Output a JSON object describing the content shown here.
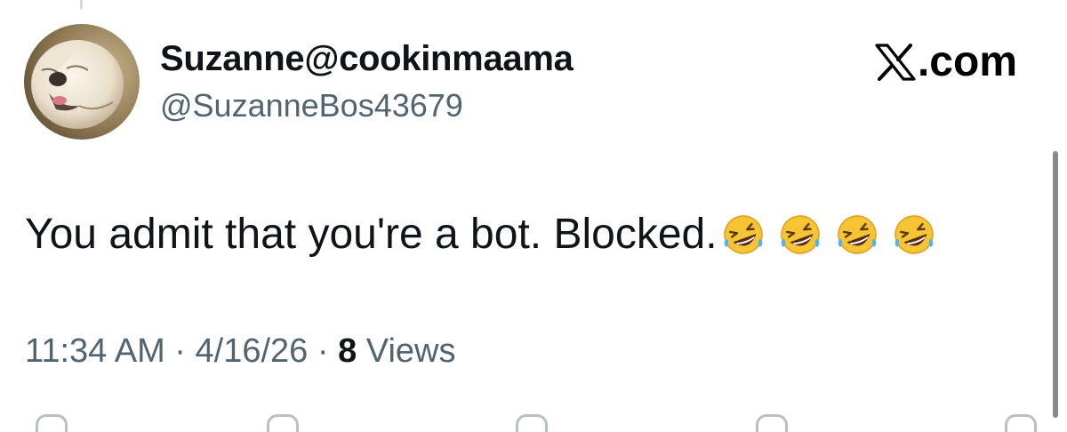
{
  "tweet": {
    "author": {
      "display_name": "Suzanne@cookinmaama",
      "handle": "@SuzanneBos43679",
      "avatar": "bulldog-photo"
    },
    "source_label": ".com",
    "source_icon": "x-logo-icon",
    "text": "You admit that you're a bot. Blocked.",
    "emoji": [
      "rolling-on-floor-laughing",
      "rolling-on-floor-laughing",
      "rolling-on-floor-laughing",
      "rolling-on-floor-laughing"
    ],
    "time": "11:34 AM",
    "separator": "·",
    "date": "4/16/26",
    "views_count": "8",
    "views_label": "Views"
  },
  "actions": [
    "reply-icon",
    "repost-icon",
    "like-icon",
    "bookmark-icon",
    "share-icon"
  ],
  "colors": {
    "text_primary": "#0f1419",
    "text_secondary": "#536471"
  }
}
